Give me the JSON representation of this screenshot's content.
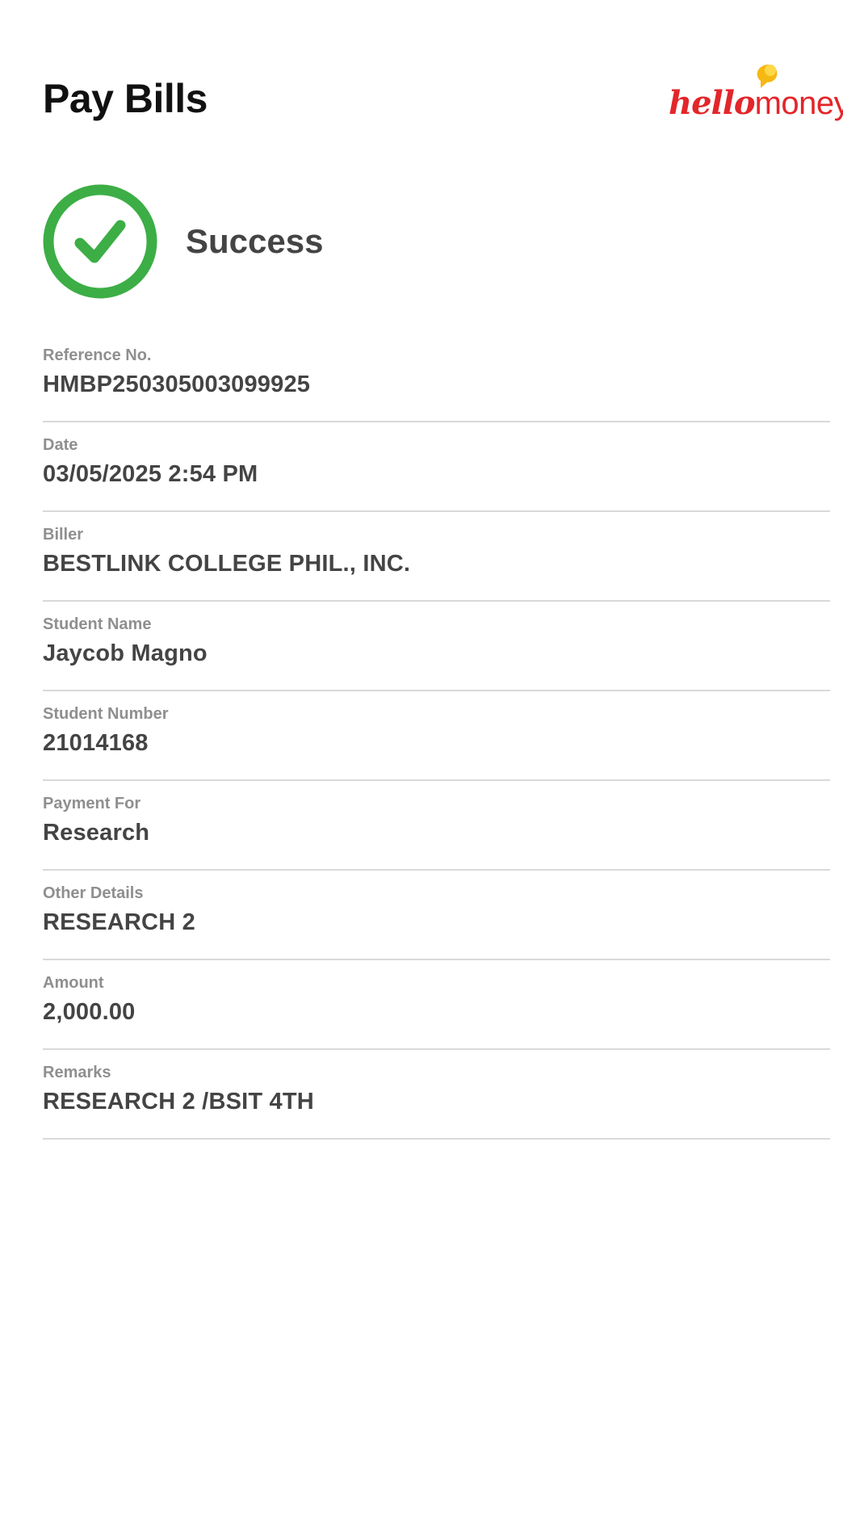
{
  "header": {
    "title": "Pay Bills",
    "brand": {
      "part1": "hello",
      "part2": "money",
      "color": "#e3262a",
      "bubble_color": "#f5b400"
    }
  },
  "status": {
    "icon": "check-circle-icon",
    "text": "Success",
    "color": "#3cae45"
  },
  "details": [
    {
      "label": "Reference No.",
      "value": "HMBP250305003099925"
    },
    {
      "label": "Date",
      "value": "03/05/2025 2:54 PM"
    },
    {
      "label": "Biller",
      "value": "BESTLINK COLLEGE PHIL., INC."
    },
    {
      "label": "Student Name",
      "value": "Jaycob Magno"
    },
    {
      "label": "Student Number",
      "value": "21014168"
    },
    {
      "label": "Payment For",
      "value": "Research"
    },
    {
      "label": "Other Details",
      "value": "RESEARCH 2"
    },
    {
      "label": "Amount",
      "value": "2,000.00"
    },
    {
      "label": "Remarks",
      "value": "RESEARCH 2 /BSIT 4TH"
    }
  ]
}
